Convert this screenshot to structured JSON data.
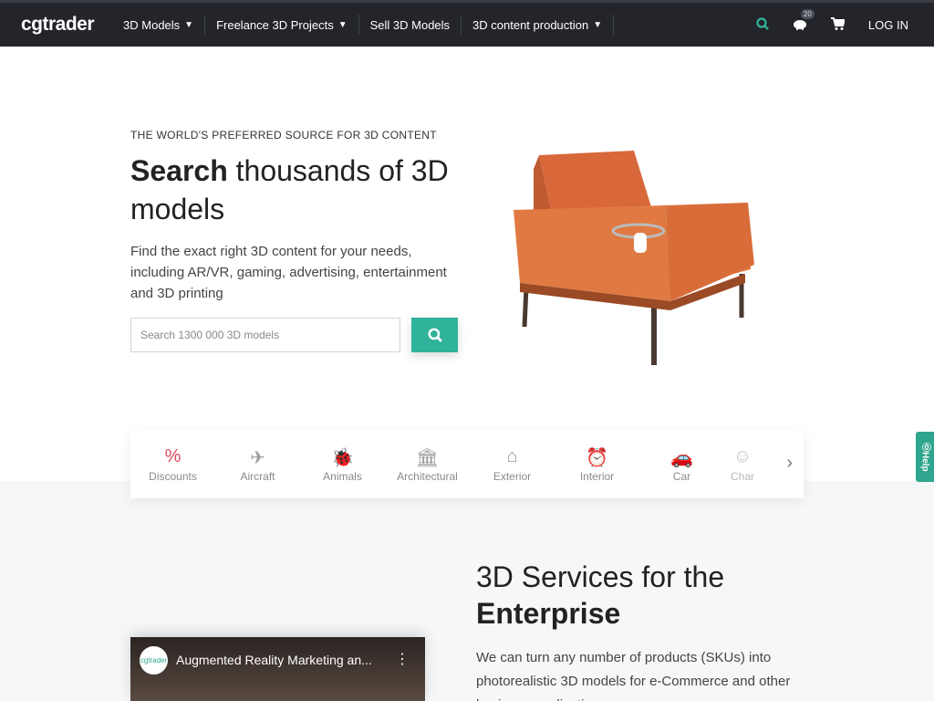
{
  "nav": {
    "logo": "cgtrader",
    "items": [
      {
        "label": "3D Models",
        "dropdown": true
      },
      {
        "label": "Freelance 3D Projects",
        "dropdown": true
      },
      {
        "label": "Sell 3D Models",
        "dropdown": false
      },
      {
        "label": "3D content production",
        "dropdown": true
      }
    ],
    "piggy_badge": "20",
    "login": "LOG IN"
  },
  "hero": {
    "eyebrow": "THE WORLD'S PREFERRED SOURCE FOR 3D CONTENT",
    "title_bold": "Search",
    "title_rest": " thousands of 3D models",
    "description": "Find the exact right 3D content for your needs, including AR/VR, gaming, advertising, entertainment and 3D printing",
    "search_placeholder": "Search 1300 000 3D models"
  },
  "categories": [
    {
      "label": "Discounts",
      "icon": "%"
    },
    {
      "label": "Aircraft",
      "icon": "✈"
    },
    {
      "label": "Animals",
      "icon": "🐞"
    },
    {
      "label": "Architectural",
      "icon": "🏛"
    },
    {
      "label": "Exterior",
      "icon": "⌂"
    },
    {
      "label": "Interior",
      "icon": "⏰"
    },
    {
      "label": "Car",
      "icon": "🚗"
    },
    {
      "label": "Char",
      "icon": "☺"
    }
  ],
  "help": "Help",
  "enterprise": {
    "title_line1": "3D Services for the",
    "title_bold": "Enterprise",
    "description": "We can turn any number of products (SKUs) into photorealistic 3D models for e-Commerce and other business applications."
  },
  "video": {
    "channel": "cgtrader",
    "title": "Augmented Reality Marketing an..."
  },
  "colors": {
    "accent": "#2fb39a",
    "nav": "#23252b",
    "discount": "#e04a5f"
  }
}
